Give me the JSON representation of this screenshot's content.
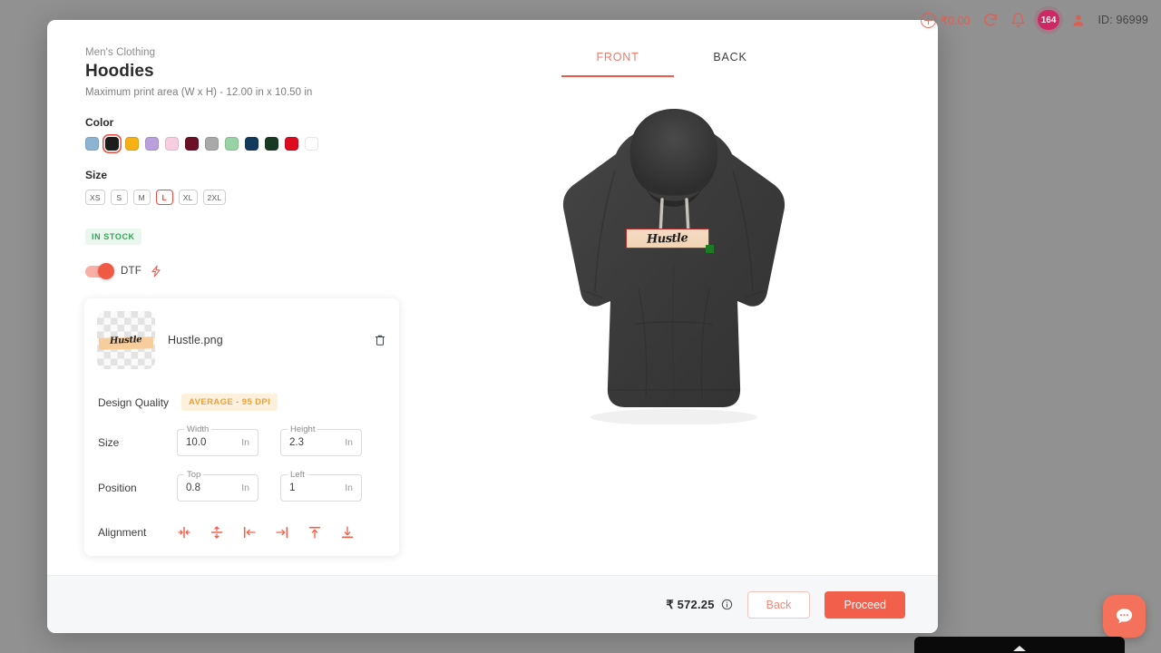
{
  "header": {
    "wallet_amount": "₹0.00",
    "notification_count": "164",
    "user_id": "ID: 96999",
    "plus_icon": "plus-circle-icon",
    "refresh_icon": "refresh-icon",
    "bell_icon": "bell-icon",
    "user_icon": "user-icon"
  },
  "product": {
    "breadcrumb": "Men's Clothing",
    "title": "Hoodies",
    "print_area": "Maximum print area (W x H) - 12.00 in x 10.50 in",
    "color_label": "Color",
    "size_label": "Size",
    "stock_status": "IN STOCK",
    "colors": [
      {
        "name": "light-blue",
        "hex": "#8cb4d2",
        "selected": false
      },
      {
        "name": "black",
        "hex": "#1c1c1c",
        "selected": true
      },
      {
        "name": "mustard",
        "hex": "#f7b114",
        "selected": false
      },
      {
        "name": "lavender",
        "hex": "#b9a0dd",
        "selected": false
      },
      {
        "name": "baby-pink",
        "hex": "#f7cde0",
        "selected": false
      },
      {
        "name": "maroon",
        "hex": "#6b1026",
        "selected": false
      },
      {
        "name": "grey",
        "hex": "#a9a9a9",
        "selected": false
      },
      {
        "name": "mint-green",
        "hex": "#97d3a4",
        "selected": false
      },
      {
        "name": "navy-blue",
        "hex": "#123a5c",
        "selected": false
      },
      {
        "name": "bottle-green",
        "hex": "#183a25",
        "selected": false
      },
      {
        "name": "red",
        "hex": "#dd0a20",
        "selected": false
      },
      {
        "name": "white",
        "hex": "#ffffff",
        "selected": false
      }
    ],
    "sizes": [
      {
        "label": "XS",
        "selected": false
      },
      {
        "label": "S",
        "selected": false
      },
      {
        "label": "M",
        "selected": false
      },
      {
        "label": "L",
        "selected": true
      },
      {
        "label": "XL",
        "selected": false
      },
      {
        "label": "2XL",
        "selected": false
      }
    ]
  },
  "print_method": {
    "label": "DTF",
    "enabled": true,
    "bolt_icon": "lightning-bolt-icon"
  },
  "design": {
    "file_name": "Hustle.png",
    "thumbnail_text": "Hustle",
    "delete_icon": "trash-icon",
    "quality_label": "Design Quality",
    "quality_value": "AVERAGE - 95 DPI",
    "size_label": "Size",
    "position_label": "Position",
    "alignment_label": "Alignment",
    "fields": {
      "width": {
        "legend": "Width",
        "value": "10.0",
        "unit": "In"
      },
      "height": {
        "legend": "Height",
        "value": "2.3",
        "unit": "In"
      },
      "top": {
        "legend": "Top",
        "value": "0.8",
        "unit": "In"
      },
      "left": {
        "legend": "Left",
        "value": "1",
        "unit": "In"
      }
    },
    "alignment_icons": [
      "align-center-horizontal-icon",
      "align-center-vertical-icon",
      "align-left-icon",
      "align-right-icon",
      "align-top-icon",
      "align-bottom-icon"
    ]
  },
  "preview": {
    "tabs": [
      {
        "label": "FRONT",
        "active": true
      },
      {
        "label": "BACK",
        "active": false
      }
    ],
    "garment_color": "#3c3c3c",
    "design_text": "Hustle",
    "selection_border_color": "#b42d2d",
    "resize_handle_color": "#1d7a24"
  },
  "footer": {
    "price": "₹ 572.25",
    "info_icon": "info-icon",
    "back_label": "Back",
    "proceed_label": "Proceed"
  },
  "chat": {
    "icon": "chat-bubble-icon",
    "color": "#f4715c"
  },
  "theme": {
    "accent": "#ef5a4a",
    "in_stock": "#36a35a",
    "quality_warn": "#e9a13b"
  }
}
